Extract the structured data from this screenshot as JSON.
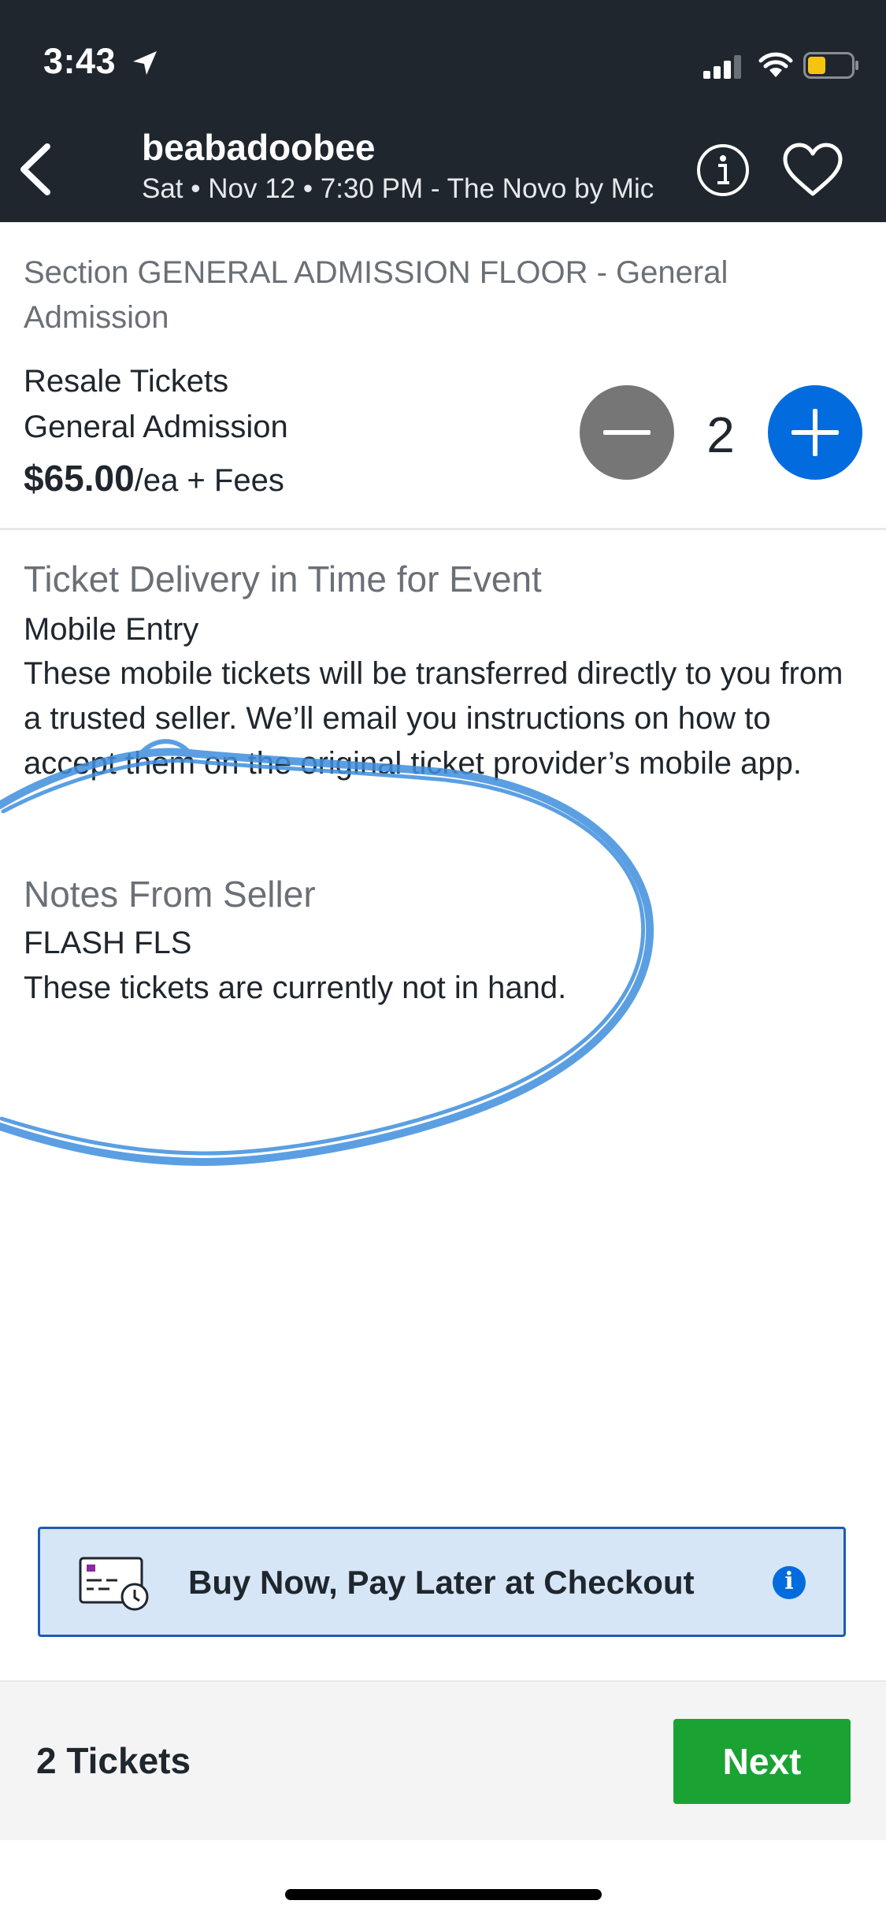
{
  "status_bar": {
    "time": "3:43",
    "icons": [
      "location-arrow-icon",
      "cellular-signal-icon",
      "wifi-icon",
      "battery-icon"
    ]
  },
  "header": {
    "title": "beabadoobee",
    "subtitle": "Sat • Nov 12 • 7:30 PM - The Novo by Mic",
    "icons": [
      "back-arrow-icon",
      "info-icon",
      "heart-icon"
    ]
  },
  "ticket": {
    "section": "Section GENERAL ADMISSION FLOOR - General Admission",
    "type": "Resale Tickets",
    "kind": "General Admission",
    "price": "$65.00",
    "price_suffix": "/ea + Fees",
    "quantity": "2"
  },
  "delivery": {
    "heading": "Ticket Delivery in Time for Event",
    "method": "Mobile Entry",
    "description": "These mobile tickets will be transferred directly to you from a trusted seller. We’ll email you instructions on how to accept them on the original ticket provider’s mobile app."
  },
  "notes": {
    "heading": "Notes From Seller",
    "code": "FLASH FLS",
    "text": "These tickets are currently not in hand."
  },
  "bnpl": {
    "label": "Buy Now, Pay Later at Checkout",
    "info_glyph": "i"
  },
  "footer": {
    "ticket_count": "2 Tickets",
    "next_label": "Next"
  },
  "colors": {
    "header_bg": "#1f262d",
    "accent_blue": "#026cdf",
    "next_green": "#1aa333",
    "minus_gray": "#767676",
    "bnpl_bg": "#d6e6f7",
    "annotation_scribble": "#3f8fde"
  }
}
